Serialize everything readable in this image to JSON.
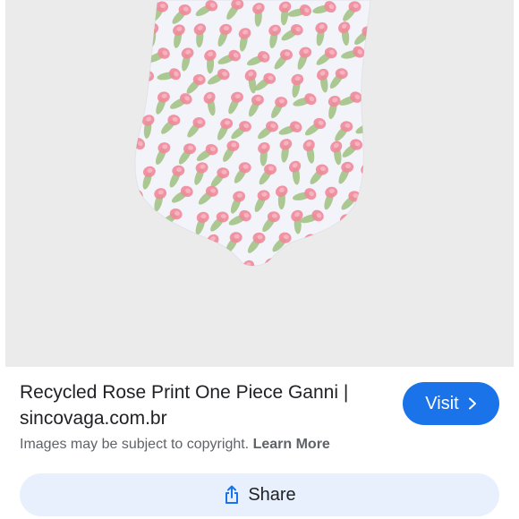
{
  "result": {
    "title_line1": "Recycled Rose Print One Piece Ganni |",
    "title_line2": "sincovaga.com.br",
    "visit_label": "Visit",
    "copyright_text": "Images may be subject to copyright.",
    "learn_more_label": "Learn More",
    "share_label": "Share"
  },
  "image": {
    "subject": "pink-rose-print-one-piece-swimsuit",
    "background_color": "#ebebeb",
    "fabric_color": "#f3f4f9",
    "flower_color": "#f08a9b",
    "leaf_color": "#9fbf80"
  },
  "colors": {
    "accent": "#1a73e8",
    "share_bg": "#e8f0fe",
    "text_primary": "#202124",
    "text_secondary": "#5f6368"
  },
  "icons": {
    "visit": "chevron-right-icon",
    "share": "share-icon"
  }
}
